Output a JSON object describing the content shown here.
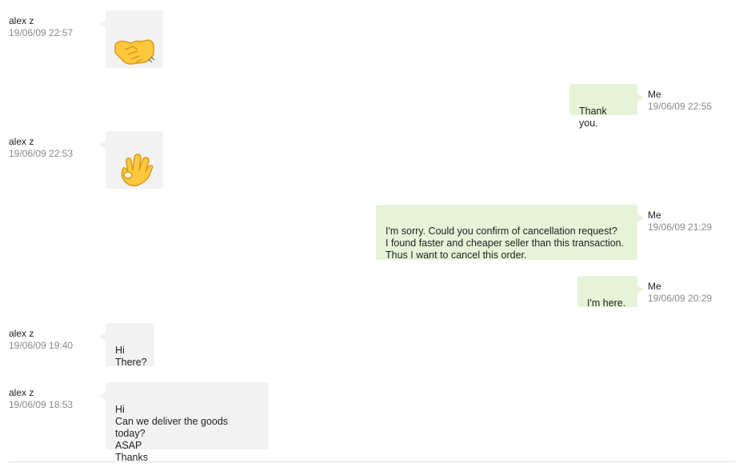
{
  "messages": [
    {
      "sender": "alex z",
      "time": "19/06/09 22:57",
      "type": "sticker",
      "sticker": "handshake-icon"
    },
    {
      "sender": "Me",
      "time": "19/06/09 22:55",
      "type": "text",
      "text": "Thank you."
    },
    {
      "sender": "alex z",
      "time": "19/06/09 22:53",
      "type": "sticker",
      "sticker": "ok-hand-icon"
    },
    {
      "sender": "Me",
      "time": "19/06/09 21:29",
      "type": "text",
      "text": "I'm sorry. Could you confirm of cancellation request?\nI found faster and cheaper seller than this transaction.\nThus I want to cancel this order."
    },
    {
      "sender": "Me",
      "time": "19/06/09 20:29",
      "type": "text",
      "text": "I'm here."
    },
    {
      "sender": "alex z",
      "time": "19/06/09 19:40",
      "type": "text",
      "text": "Hi\nThere?"
    },
    {
      "sender": "alex z",
      "time": "19/06/09 18:53",
      "type": "text",
      "text": "Hi\nCan we deliver the goods today?\nASAP\nThanks"
    }
  ],
  "colors": {
    "incoming_bubble": "#f2f2f2",
    "outgoing_bubble": "#e6f3d8",
    "timestamp": "#8a8a8a",
    "sticker_yellow": "#ffc83d"
  }
}
